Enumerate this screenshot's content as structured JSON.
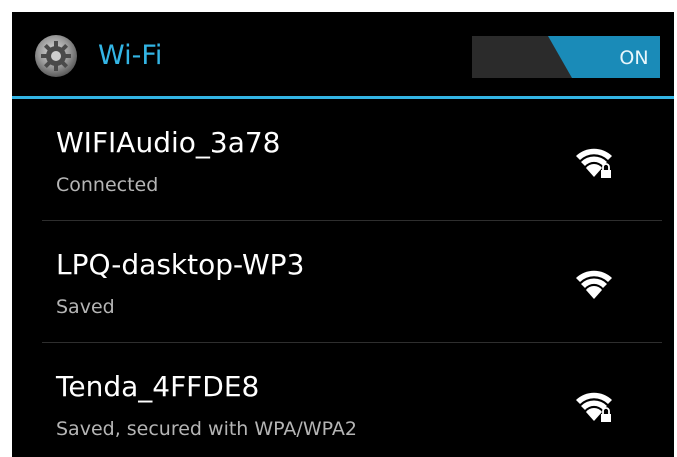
{
  "header": {
    "icon": "settings-gear-icon",
    "title": "Wi-Fi",
    "toggle_label": "ON",
    "accent_color": "#33b5e5"
  },
  "networks": [
    {
      "name": "WIFIAudio_3a78",
      "status": "Connected",
      "icon": "wifi-signal-locked-icon"
    },
    {
      "name": "LPQ-dasktop-WP3",
      "status": "Saved",
      "icon": "wifi-signal-icon"
    },
    {
      "name": "Tenda_4FFDE8",
      "status": "Saved, secured with WPA/WPA2",
      "icon": "wifi-signal-locked-icon"
    }
  ]
}
